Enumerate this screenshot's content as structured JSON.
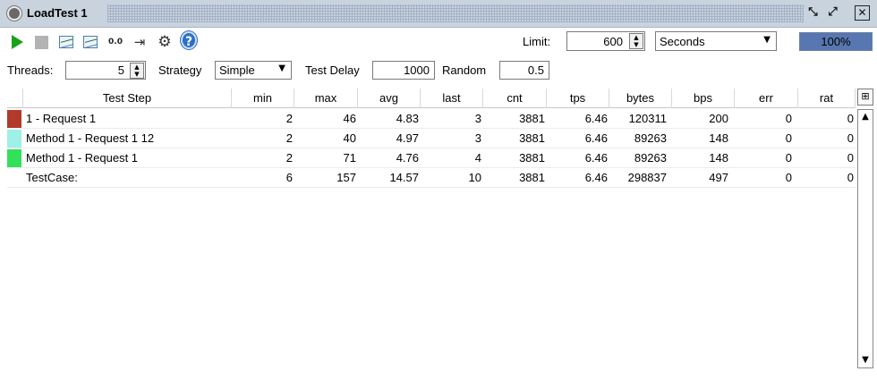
{
  "window": {
    "title": "LoadTest 1",
    "icons": [
      "loadtest-icon",
      "minimize-icon",
      "restore-icon",
      "close-icon"
    ]
  },
  "toolbar": {
    "icons": [
      "run-icon",
      "stop-icon",
      "statistics-graph-icon",
      "statistics-history-icon",
      "statistics-report-icon",
      "export-icon",
      "options-icon",
      "help-icon"
    ],
    "report_label": "0.0",
    "limit_label": "Limit:",
    "limit_value": "600",
    "limit_unit": "Seconds",
    "progress_text": "100%",
    "progress_fraction": 1.0
  },
  "config": {
    "threads_label": "Threads:",
    "threads_value": "5",
    "strategy_label": "Strategy",
    "strategy_value": "Simple",
    "test_delay_label": "Test Delay",
    "test_delay_value": "1000",
    "random_label": "Random",
    "random_value": "0.5"
  },
  "table": {
    "columns": [
      "Test Step",
      "min",
      "max",
      "avg",
      "last",
      "cnt",
      "tps",
      "bytes",
      "bps",
      "err",
      "rat"
    ],
    "rows": [
      {
        "color": "#b23a2a",
        "step": "1 - Request 1",
        "min": "2",
        "max": "46",
        "avg": "4.83",
        "last": "3",
        "cnt": "3881",
        "tps": "6.46",
        "bytes": "120311",
        "bps": "200",
        "err": "0",
        "rat": "0"
      },
      {
        "color": "#9ff0e6",
        "step": "Method 1 - Request 1 12",
        "min": "2",
        "max": "40",
        "avg": "4.97",
        "last": "3",
        "cnt": "3881",
        "tps": "6.46",
        "bytes": "89263",
        "bps": "148",
        "err": "0",
        "rat": "0"
      },
      {
        "color": "#33e05a",
        "step": "Method 1 - Request 1",
        "min": "2",
        "max": "71",
        "avg": "4.76",
        "last": "4",
        "cnt": "3881",
        "tps": "6.46",
        "bytes": "89263",
        "bps": "148",
        "err": "0",
        "rat": "0"
      },
      {
        "color": "",
        "step": "TestCase:",
        "min": "6",
        "max": "157",
        "avg": "14.57",
        "last": "10",
        "cnt": "3881",
        "tps": "6.46",
        "bytes": "298837",
        "bps": "497",
        "err": "0",
        "rat": "0"
      }
    ]
  }
}
